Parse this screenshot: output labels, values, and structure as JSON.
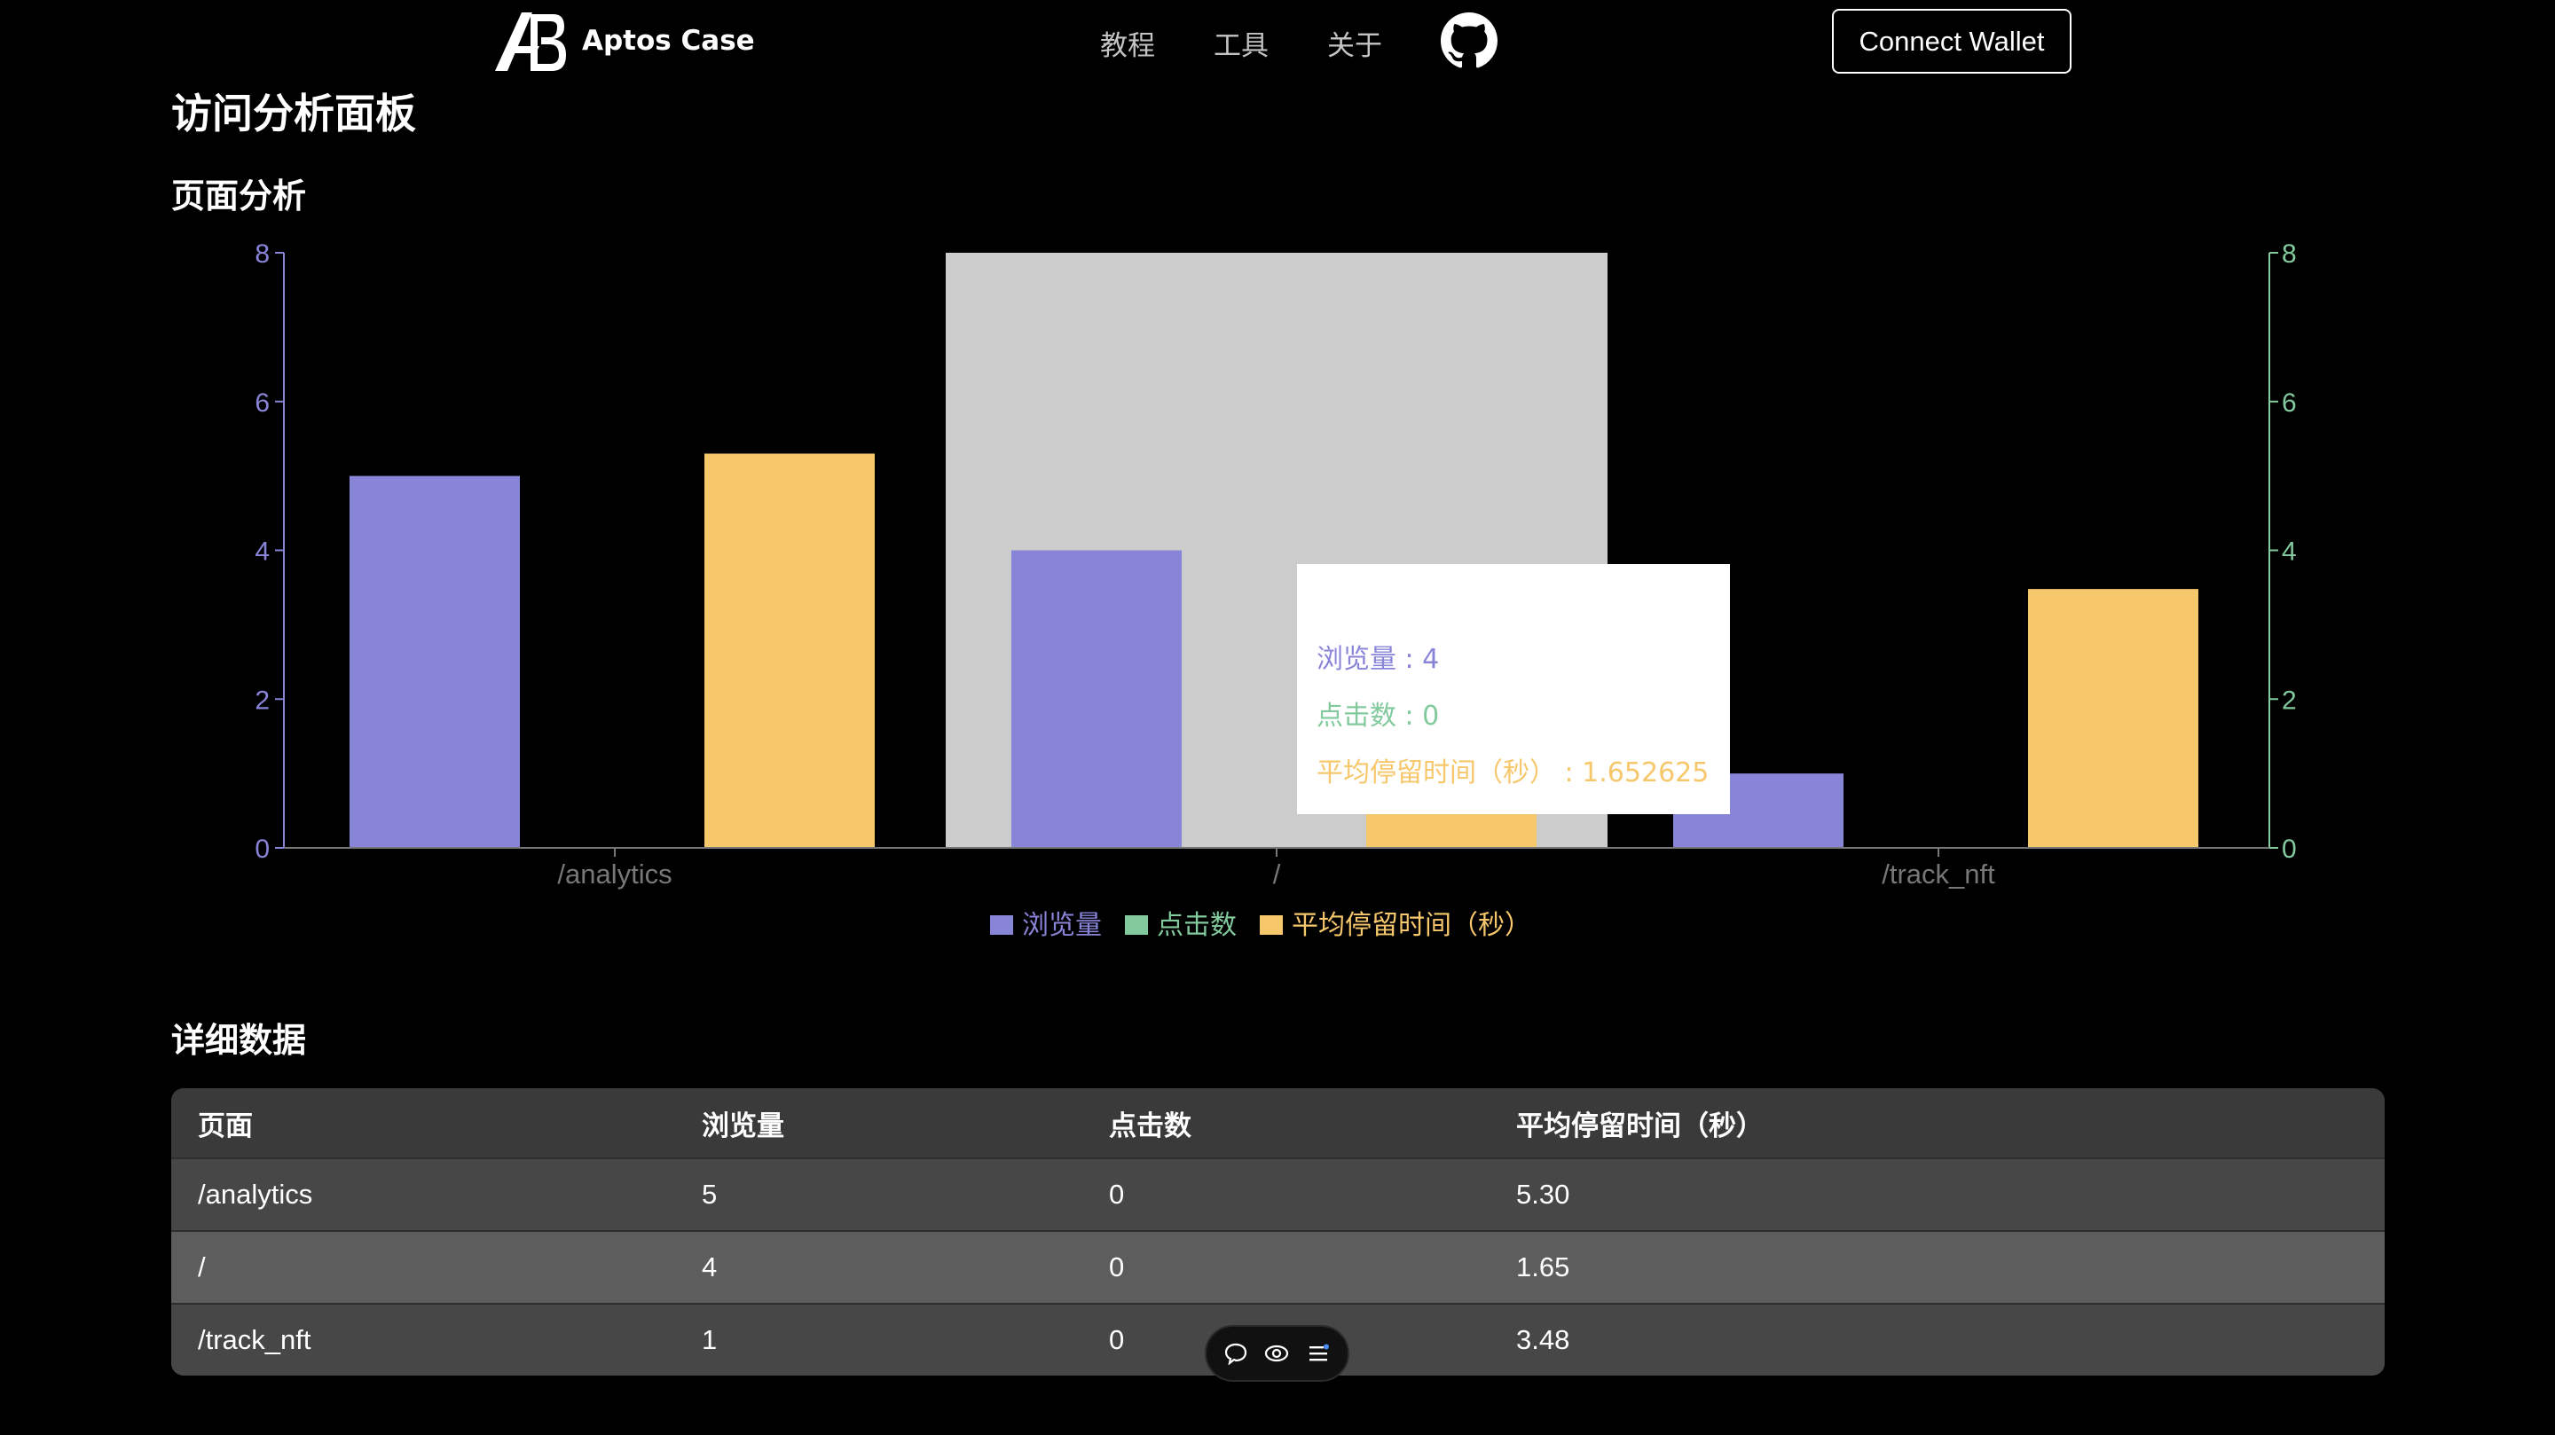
{
  "header": {
    "brand": "Aptos Case",
    "nav": [
      "教程",
      "工具",
      "关于"
    ],
    "connect_label": "Connect Wallet"
  },
  "page_title": "访问分析面板",
  "section_chart_title": "页面分析",
  "section_table_title": "详细数据",
  "colors": {
    "views": "#8884d8",
    "clicks": "#82ca9d",
    "duration": "#f7c76c",
    "highlight": "#cccccc"
  },
  "chart_data": {
    "type": "bar",
    "categories": [
      "/analytics",
      "/",
      "/track_nft"
    ],
    "series": [
      {
        "name": "浏览量",
        "values": [
          5,
          4,
          1
        ],
        "axis": "left"
      },
      {
        "name": "点击数",
        "values": [
          0,
          0,
          0
        ],
        "axis": "right"
      },
      {
        "name": "平均停留时间（秒）",
        "values": [
          5.3,
          1.652625,
          3.48
        ],
        "axis": "right"
      }
    ],
    "ylim_left": [
      0,
      8
    ],
    "ylim_right": [
      0,
      8
    ],
    "yticks": [
      0,
      2,
      4,
      6,
      8
    ],
    "legend_position": "bottom-center",
    "highlighted_category": "/"
  },
  "tooltip": {
    "rows": [
      "浏览量 : 4",
      "点击数 : 0",
      "平均停留时间（秒） : 1.652625"
    ]
  },
  "table": {
    "headers": [
      "页面",
      "浏览量",
      "点击数",
      "平均停留时间（秒）"
    ],
    "rows": [
      [
        "/analytics",
        "5",
        "0",
        "5.30"
      ],
      [
        "/",
        "4",
        "0",
        "1.65"
      ],
      [
        "/track_nft",
        "1",
        "0",
        "3.48"
      ]
    ]
  },
  "toolbar": {
    "icons": [
      "comment-icon",
      "eye-icon",
      "menu-icon"
    ]
  }
}
